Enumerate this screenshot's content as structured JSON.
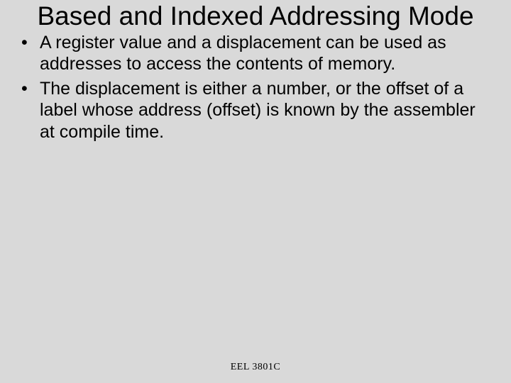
{
  "title": "Based and Indexed Addressing Mode",
  "bullets": [
    "A register value and a displacement can be used as addresses to access the contents of memory.",
    "The displacement is either a number, or the offset of a label whose address (offset) is known by the assembler at compile time."
  ],
  "footer": "EEL 3801C"
}
